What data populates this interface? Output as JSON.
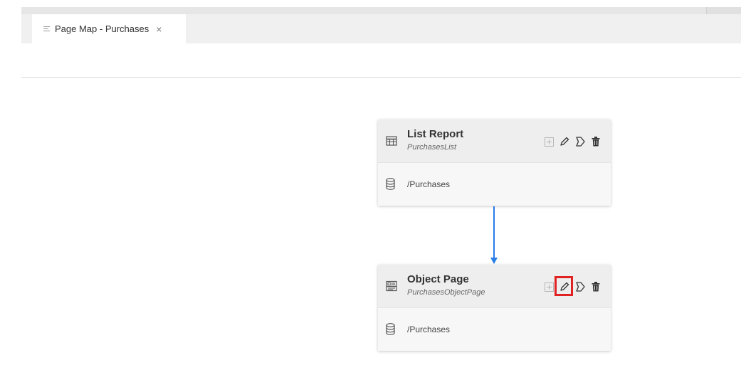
{
  "tab": {
    "label": "Page Map - Purchases",
    "close_glyph": "×",
    "icon": "lines-icon"
  },
  "pages": [
    {
      "title": "List Report",
      "subtitle": "PurchasesList",
      "entity_set": "/Purchases",
      "icon": "table-icon",
      "actions": [
        "add-icon",
        "pencil-icon",
        "tag-icon",
        "trash-icon"
      ]
    },
    {
      "title": "Object Page",
      "subtitle": "PurchasesObjectPage",
      "entity_set": "/Purchases",
      "icon": "object-page-icon",
      "actions": [
        "add-icon",
        "pencil-icon",
        "tag-icon",
        "trash-icon"
      ],
      "highlighted_action": "pencil-icon"
    }
  ],
  "colors": {
    "connector": "#2b7de9",
    "highlight": "#e02222",
    "icon": "#555555"
  }
}
